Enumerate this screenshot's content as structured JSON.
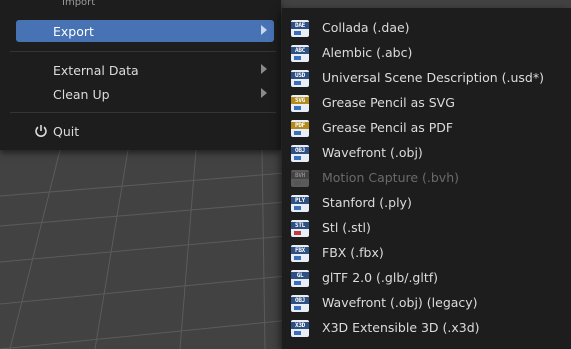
{
  "file_menu": {
    "peek_text": "Import",
    "items": [
      {
        "label": "Export",
        "active": true,
        "has_submenu": true
      },
      {
        "label": "External Data",
        "active": false,
        "has_submenu": true
      },
      {
        "label": "Clean Up",
        "active": false,
        "has_submenu": true
      },
      {
        "label": "Quit",
        "active": false,
        "has_submenu": false,
        "icon": "power-icon"
      }
    ]
  },
  "export_menu": {
    "items": [
      {
        "label": "Collada (.dae)",
        "icon_tag": "DAE",
        "icon": "collada-file-icon",
        "enabled": true
      },
      {
        "label": "Alembic (.abc)",
        "icon_tag": "ABC",
        "icon": "alembic-file-icon",
        "enabled": true
      },
      {
        "label": "Universal Scene Description (.usd*)",
        "icon_tag": "USD",
        "icon": "usd-file-icon",
        "enabled": true
      },
      {
        "label": "Grease Pencil as SVG",
        "icon_tag": "SVG",
        "icon": "svg-file-icon",
        "enabled": true
      },
      {
        "label": "Grease Pencil as PDF",
        "icon_tag": "PDF",
        "icon": "pdf-file-icon",
        "enabled": true
      },
      {
        "label": "Wavefront (.obj)",
        "icon_tag": "OBJ",
        "icon": "obj-file-icon",
        "enabled": true
      },
      {
        "label": "Motion Capture (.bvh)",
        "icon_tag": "BVH",
        "icon": "bvh-file-icon",
        "enabled": false
      },
      {
        "label": "Stanford (.ply)",
        "icon_tag": "PLY",
        "icon": "ply-file-icon",
        "enabled": true
      },
      {
        "label": "Stl (.stl)",
        "icon_tag": "STL",
        "icon": "stl-file-icon",
        "enabled": true
      },
      {
        "label": "FBX (.fbx)",
        "icon_tag": "FBX",
        "icon": "fbx-file-icon",
        "enabled": true
      },
      {
        "label": "glTF 2.0 (.glb/.gltf)",
        "icon_tag": "GL",
        "icon": "gltf-file-icon",
        "enabled": true
      },
      {
        "label": "Wavefront (.obj) (legacy)",
        "icon_tag": "OBJ",
        "icon": "obj-legacy-file-icon",
        "enabled": true
      },
      {
        "label": "X3D Extensible 3D (.x3d)",
        "icon_tag": "X3D",
        "icon": "x3d-file-icon",
        "enabled": true
      }
    ]
  },
  "colors": {
    "menu_bg": "#1d1d1d",
    "highlight": "#4772b3",
    "viewport_bg": "#424242",
    "grid_line": "#5a5a5a",
    "disabled_text": "#6a6a6a"
  }
}
